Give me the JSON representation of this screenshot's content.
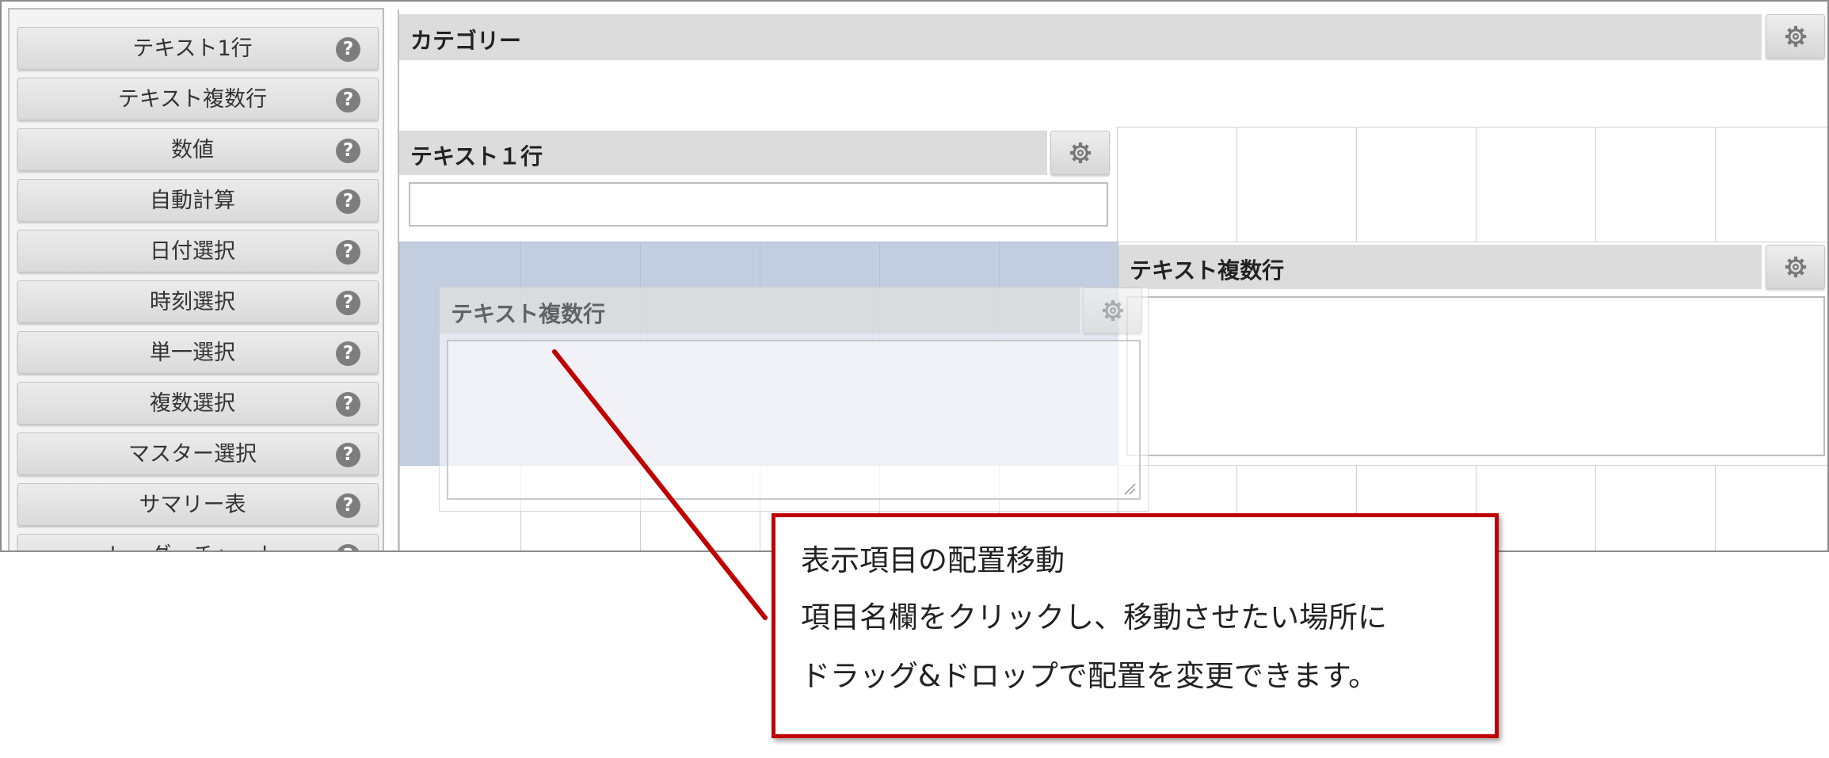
{
  "palette": {
    "items": [
      {
        "label": "テキスト1行"
      },
      {
        "label": "テキスト複数行"
      },
      {
        "label": "数値"
      },
      {
        "label": "自動計算"
      },
      {
        "label": "日付選択"
      },
      {
        "label": "時刻選択"
      },
      {
        "label": "単一選択"
      },
      {
        "label": "複数選択"
      },
      {
        "label": "マスター選択"
      },
      {
        "label": "サマリー表"
      },
      {
        "label": "レーダーチャート"
      }
    ],
    "help_glyph": "?"
  },
  "canvas": {
    "category_header": {
      "title": "カテゴリー"
    },
    "text_single_field": {
      "title": "テキスト１行",
      "value": ""
    },
    "text_multi_field": {
      "title": "テキスト複数行",
      "value": ""
    },
    "drag_ghost": {
      "title": "テキスト複数行"
    }
  },
  "callout": {
    "line1": "表示項目の配置移動",
    "line2": "項目名欄をクリックし、移動させたい場所に",
    "line3": "ドラッグ&ドロップで配置を変更できます。"
  },
  "icons": {
    "help": "question-circle-icon",
    "settings": "gear-icon",
    "resize": "resize-grip-icon"
  },
  "colors": {
    "callout_border": "#c00000",
    "drop_zone": "#c3cde0",
    "header_bg": "#dcdcdc"
  }
}
